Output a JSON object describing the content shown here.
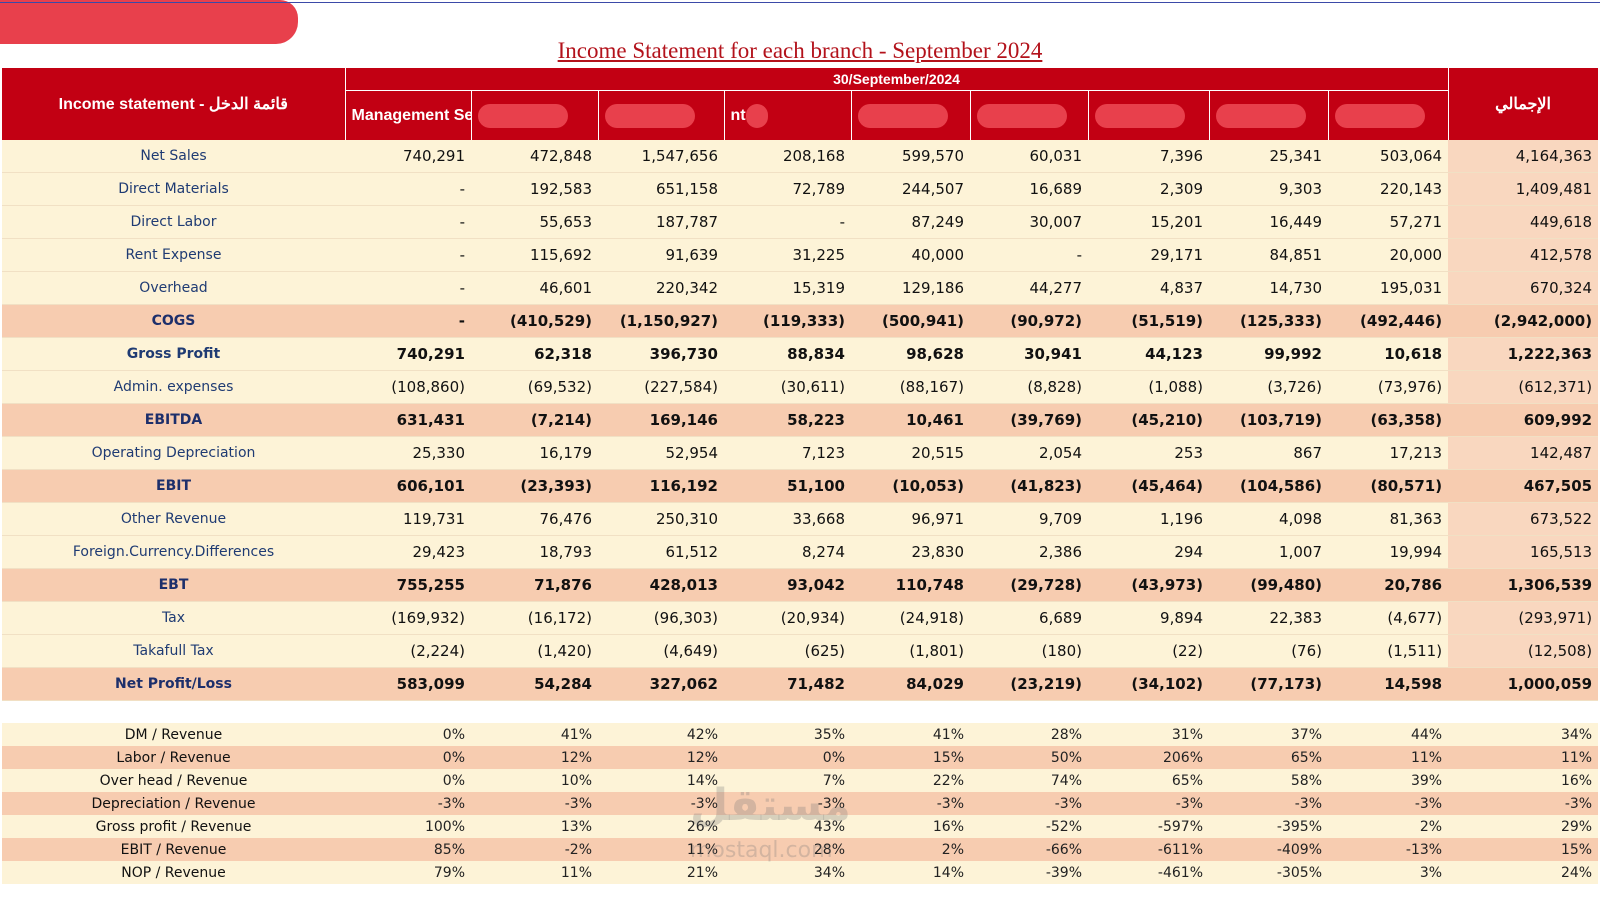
{
  "title": "Income Statement for each branch - September 2024",
  "header": {
    "label": "Income statement - قائمة الدخل",
    "date": "30/September/2024",
    "branches": [
      "Management Services",
      "",
      "",
      "nt",
      "",
      "",
      "",
      "",
      ""
    ],
    "total": "الإجمالي"
  },
  "rows": [
    {
      "label": "Net Sales",
      "style": "light",
      "values": [
        "740,291",
        "472,848",
        "1,547,656",
        "208,168",
        "599,570",
        "60,031",
        "7,396",
        "25,341",
        "503,064",
        "4,164,363"
      ]
    },
    {
      "label": "Direct Materials",
      "style": "light",
      "values": [
        "-",
        "192,583",
        "651,158",
        "72,789",
        "244,507",
        "16,689",
        "2,309",
        "9,303",
        "220,143",
        "1,409,481"
      ]
    },
    {
      "label": "Direct Labor",
      "style": "light",
      "values": [
        "-",
        "55,653",
        "187,787",
        "-",
        "87,249",
        "30,007",
        "15,201",
        "16,449",
        "57,271",
        "449,618"
      ]
    },
    {
      "label": "Rent Expense",
      "style": "light",
      "values": [
        "-",
        "115,692",
        "91,639",
        "31,225",
        "40,000",
        "-",
        "29,171",
        "84,851",
        "20,000",
        "412,578"
      ]
    },
    {
      "label": "Overhead",
      "style": "light",
      "values": [
        "-",
        "46,601",
        "220,342",
        "15,319",
        "129,186",
        "44,277",
        "4,837",
        "14,730",
        "195,031",
        "670,324"
      ]
    },
    {
      "label": "COGS",
      "style": "hl",
      "values": [
        "-",
        "(410,529)",
        "(1,150,927)",
        "(119,333)",
        "(500,941)",
        "(90,972)",
        "(51,519)",
        "(125,333)",
        "(492,446)",
        "(2,942,000)"
      ]
    },
    {
      "label": "Gross Profit",
      "style": "light-bold",
      "values": [
        "740,291",
        "62,318",
        "396,730",
        "88,834",
        "98,628",
        "30,941",
        "44,123",
        "99,992",
        "10,618",
        "1,222,363"
      ]
    },
    {
      "label": "Admin. expenses",
      "style": "light",
      "values": [
        "(108,860)",
        "(69,532)",
        "(227,584)",
        "(30,611)",
        "(88,167)",
        "(8,828)",
        "(1,088)",
        "(3,726)",
        "(73,976)",
        "(612,371)"
      ]
    },
    {
      "label": "EBITDA",
      "style": "hl",
      "values": [
        "631,431",
        "(7,214)",
        "169,146",
        "58,223",
        "10,461",
        "(39,769)",
        "(45,210)",
        "(103,719)",
        "(63,358)",
        "609,992"
      ]
    },
    {
      "label": "Operating Depreciation",
      "style": "light",
      "values": [
        "25,330",
        "16,179",
        "52,954",
        "7,123",
        "20,515",
        "2,054",
        "253",
        "867",
        "17,213",
        "142,487"
      ]
    },
    {
      "label": "EBIT",
      "style": "hl",
      "values": [
        "606,101",
        "(23,393)",
        "116,192",
        "51,100",
        "(10,053)",
        "(41,823)",
        "(45,464)",
        "(104,586)",
        "(80,571)",
        "467,505"
      ]
    },
    {
      "label": "Other Revenue",
      "style": "light",
      "values": [
        "119,731",
        "76,476",
        "250,310",
        "33,668",
        "96,971",
        "9,709",
        "1,196",
        "4,098",
        "81,363",
        "673,522"
      ]
    },
    {
      "label": "Foreign.Currency.Differences",
      "style": "light",
      "values": [
        "29,423",
        "18,793",
        "61,512",
        "8,274",
        "23,830",
        "2,386",
        "294",
        "1,007",
        "19,994",
        "165,513"
      ]
    },
    {
      "label": "EBT",
      "style": "hl",
      "values": [
        "755,255",
        "71,876",
        "428,013",
        "93,042",
        "110,748",
        "(29,728)",
        "(43,973)",
        "(99,480)",
        "20,786",
        "1,306,539"
      ]
    },
    {
      "label": "Tax",
      "style": "light",
      "values": [
        "(169,932)",
        "(16,172)",
        "(96,303)",
        "(20,934)",
        "(24,918)",
        "6,689",
        "9,894",
        "22,383",
        "(4,677)",
        "(293,971)"
      ]
    },
    {
      "label": "Takafull Tax",
      "style": "light",
      "values": [
        "(2,224)",
        "(1,420)",
        "(4,649)",
        "(625)",
        "(1,801)",
        "(180)",
        "(22)",
        "(76)",
        "(1,511)",
        "(12,508)"
      ]
    },
    {
      "label": "Net Profit/Loss",
      "style": "hl",
      "values": [
        "583,099",
        "54,284",
        "327,062",
        "71,482",
        "84,029",
        "(23,219)",
        "(34,102)",
        "(77,173)",
        "14,598",
        "1,000,059"
      ]
    }
  ],
  "ratios": [
    {
      "label": "DM / Revenue",
      "values": [
        "0%",
        "41%",
        "42%",
        "35%",
        "41%",
        "28%",
        "31%",
        "37%",
        "44%",
        "34%"
      ]
    },
    {
      "label": "Labor / Revenue",
      "values": [
        "0%",
        "12%",
        "12%",
        "0%",
        "15%",
        "50%",
        "206%",
        "65%",
        "11%",
        "11%"
      ]
    },
    {
      "label": "Over head / Revenue",
      "values": [
        "0%",
        "10%",
        "14%",
        "7%",
        "22%",
        "74%",
        "65%",
        "58%",
        "39%",
        "16%"
      ]
    },
    {
      "label": "Depreciation / Revenue",
      "values": [
        "-3%",
        "-3%",
        "-3%",
        "-3%",
        "-3%",
        "-3%",
        "-3%",
        "-3%",
        "-3%",
        "-3%"
      ]
    },
    {
      "label": "Gross profit / Revenue",
      "values": [
        "100%",
        "13%",
        "26%",
        "43%",
        "16%",
        "-52%",
        "-597%",
        "-395%",
        "2%",
        "29%"
      ]
    },
    {
      "label": "EBIT / Revenue",
      "values": [
        "85%",
        "-2%",
        "11%",
        "28%",
        "2%",
        "-66%",
        "-611%",
        "-409%",
        "-13%",
        "15%"
      ]
    },
    {
      "label": "NOP / Revenue",
      "values": [
        "79%",
        "11%",
        "21%",
        "34%",
        "14%",
        "-39%",
        "-461%",
        "-305%",
        "3%",
        "24%"
      ]
    }
  ],
  "watermark": {
    "main": "مستقل",
    "sub": "mostaql.com"
  },
  "colors": {
    "header_red": "#c20013",
    "light_row": "#fdf3d7",
    "highlight_row": "#f7ccb0",
    "title_red": "#b3121b"
  }
}
